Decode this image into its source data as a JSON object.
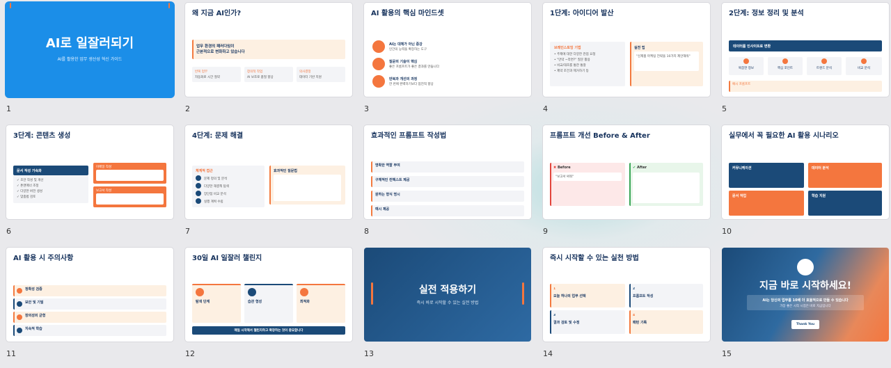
{
  "slides": [
    {
      "num": "1",
      "title": "AI로 일잘러되기",
      "subtitle": "AI를 활용한 업무 생산성 혁신 가이드"
    },
    {
      "num": "2",
      "title": "왜 지금 AI인가?",
      "callout": "업무 환경의 패러다임이\n근본적으로 변화하고 있습니다",
      "c1h": "반복 업무",
      "c1": "자동화로 시간 절약",
      "c2h": "창의적 작업",
      "c2": "AI 보조로 품질 향상",
      "c3h": "의사결정",
      "c3": "데이터 기반 지원"
    },
    {
      "num": "3",
      "title": "AI 활용의 핵심 마인드셋",
      "i1": "AI는 대체가 아닌 증강",
      "i1s": "인간의 능력을 확장하는 도구",
      "i2": "질문의 기술이 핵심",
      "i2s": "좋은 프롬프트가 좋은 결과를 만듭니다",
      "i3": "반복과 개선의 과정",
      "i3s": "한 번에 완벽하기보다 점진적 향상"
    },
    {
      "num": "4",
      "title": "1단계: 아이디어 발산",
      "lh": "브레인스토밍 기법",
      "l1": "• 주제에 대한 다양한 관점 요청",
      "l2": "• \"만약 ~라면?\" 질문 활용",
      "l3": "• 비교/대조를 통한 통찰",
      "l4": "• 제약 조건과 제거하기 등",
      "rh": "실전 팁",
      "r1": "\"신제품 마케팅 전략을 10가지 제안해줘\""
    },
    {
      "num": "5",
      "title": "2단계: 정보 정리 및 분석",
      "banner": "데이터를 인사이트로 변환",
      "k1": "복잡한 정보",
      "k1s": "요약 및 구조화",
      "k2": "핵심 포인트",
      "k2s": "추출 및 정리",
      "k3": "트렌드 분석",
      "k3s": "패턴 발견",
      "k4": "비교 분석",
      "k4s": "장단점 정리",
      "ex": "예시 프롬프트"
    },
    {
      "num": "6",
      "title": "3단계: 콘텐츠 생성",
      "left": "문서 작성 가속화",
      "l1": "✓ 초안 작성 및 개선",
      "l2": "✓ 톤앤매너 조정",
      "l3": "✓ 다양한 버전 생성",
      "l4": "✓ 맞춤법 검토",
      "r1h": "이메일 작성",
      "r2h": "보고서 작성"
    },
    {
      "num": "7",
      "title": "4단계: 문제 해결",
      "lh": "체계적 접근",
      "s1": "문제 정의 및 분석",
      "s2": "다양한 해결책 탐색",
      "s3": "장단점 비교 분석",
      "s4": "실행 계획 수립",
      "rh": "효과적인 질문법"
    },
    {
      "num": "8",
      "title": "효과적인 프롬프트 작성법",
      "p1": "명확한 역할 부여",
      "p2": "구체적인 컨텍스트 제공",
      "p3": "원하는 형식 명시",
      "p4": "예시 제공"
    },
    {
      "num": "9",
      "title": "프롬프트 개선 Before & After",
      "before": "Before",
      "bq": "\"보고서 써줘\"",
      "after": "After"
    },
    {
      "num": "10",
      "title": "실무에서 꼭 필요한 AI 활용 시나리오",
      "q1": "커뮤니케이션",
      "q2": "데이터 분석",
      "q3": "문서 작업",
      "q4": "학습 지원"
    },
    {
      "num": "11",
      "title": "AI 활용 시 주의사항",
      "w1": "정확성 검증",
      "w2": "보안 및 기밀",
      "w3": "창의성의 균형",
      "w4": "지속적 학습"
    },
    {
      "num": "12",
      "title": "30일 AI 일잘러 챌린지",
      "c1": "탐색 단계",
      "c2": "습관 형성",
      "c3": "최적화",
      "bar": "매일 시작해서 챌린지하고 확장하는 것이 중요합니다"
    },
    {
      "num": "13",
      "title": "실전 적용하기",
      "subtitle": "즉시 바로 시작할 수 있는 실전 방법"
    },
    {
      "num": "14",
      "title": "즉시 시작할 수 있는 실천 방법",
      "a1": "오늘 하나의 업무 선택",
      "a2": "프롬프트 작성",
      "a3": "결과 검토 및 수정",
      "a4": "패턴 기록"
    },
    {
      "num": "15",
      "title": "지금 바로 시작하세요!",
      "body": "AI는 당신의 업무를 10배 더 효율적으로 만들 수 있습니다",
      "sub": "가장 좋은 시작 시점은 바로 지금입니다",
      "button": "Thank You"
    }
  ],
  "colors": {
    "blue": "#1b8ee8",
    "navy": "#1b4a78",
    "orange": "#f4763e",
    "cream": "#fdf0e2"
  }
}
